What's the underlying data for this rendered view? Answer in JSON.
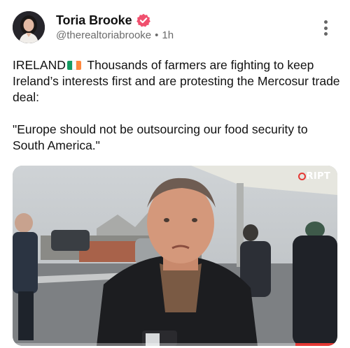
{
  "author": {
    "display_name": "Toria Brooke",
    "handle": "@therealtoriabrooke",
    "separator": "•",
    "time": "1h",
    "verified": true
  },
  "icons": {
    "verified": "verified-badge-icon",
    "more": "more-vertical-icon",
    "flag": "ireland-flag-emoji"
  },
  "post": {
    "lead": "IRELAND",
    "body": "Thousands of farmers are fighting to keep Ireland’s interests first and are protesting the Mercosur trade deal:",
    "quote": "\"Europe should not be outsourcing our food security to South America.\""
  },
  "media": {
    "watermark": "RIPT"
  },
  "colors": {
    "verified": "#f0506e",
    "flag_green": "#169b62",
    "flag_white": "#ffffff",
    "flag_orange": "#ff883e",
    "watermark_accent": "#e53935"
  }
}
